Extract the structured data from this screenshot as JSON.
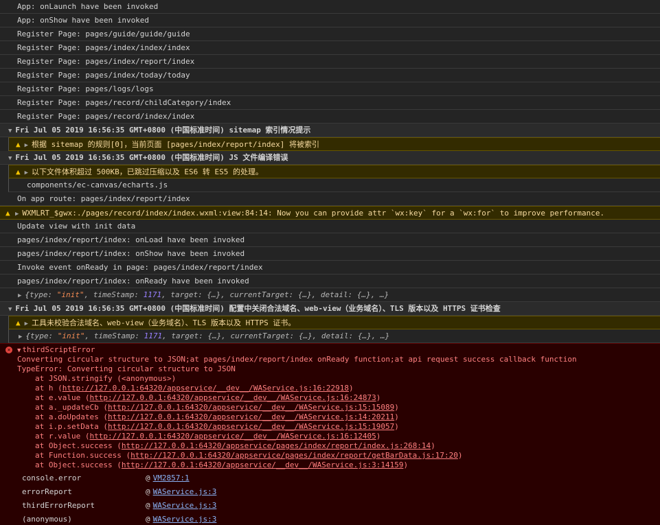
{
  "logs": [
    "App: onLaunch have been invoked",
    "App: onShow have been invoked",
    "Register Page: pages/guide/guide/guide",
    "Register Page: pages/index/index/index",
    "Register Page: pages/index/report/index",
    "Register Page: pages/index/today/today",
    "Register Page: pages/logs/logs",
    "Register Page: pages/record/childCategory/index",
    "Register Page: pages/record/index/index"
  ],
  "group1": {
    "header": "Fri Jul 05 2019 16:56:35 GMT+0800 (中国标准时间) sitemap 索引情况提示",
    "warning": "根据 sitemap 的规则[0]，当前页面 [pages/index/report/index] 将被索引"
  },
  "group2": {
    "header": "Fri Jul 05 2019 16:56:35 GMT+0800 (中国标准时间) JS 文件编译错误",
    "warning": "以下文件体积超过 500KB，已跳过压缩以及 ES6 转 ES5 的处理。",
    "file": "components/ec-canvas/echarts.js"
  },
  "route": "On app route: pages/index/report/index",
  "wxml_warning": "WXMLRT_$gwx:./pages/record/index/index.wxml:view:84:14: Now you can provide attr `wx:key` for a `wx:for` to improve performance.",
  "logs2": [
    "Update view with init data",
    "pages/index/report/index: onLoad have been invoked",
    "pages/index/report/index: onShow have been invoked",
    "Invoke event onReady in page: pages/index/report/index",
    "pages/index/report/index: onReady have been invoked"
  ],
  "obj": {
    "brace_open": "{",
    "type_key": "type: ",
    "type_val": "\"init\"",
    "ts_key": ", timeStamp: ",
    "ts_val": "1171",
    "rest": ", target: {…}, currentTarget: {…}, detail: {…}, …}"
  },
  "group3": {
    "header": "Fri Jul 05 2019 16:56:35 GMT+0800 (中国标准时间) 配置中关闭合法域名、web-view（业务域名）、TLS 版本以及 HTTPS 证书检查",
    "warning": "工具未校验合法域名、web-view（业务域名）、TLS 版本以及 HTTPS 证书。"
  },
  "error": {
    "title": "thirdScriptError",
    "message": "Converting circular structure to JSON;at pages/index/report/index onReady function;at api request success callback function",
    "type_error": "TypeError: Converting circular structure to JSON",
    "stack": [
      {
        "prefix": "at JSON.stringify (<anonymous>)",
        "link": "",
        "suffix": ""
      },
      {
        "prefix": "at h (",
        "link": "http://127.0.0.1:64320/appservice/__dev__/WAService.js:16:22918",
        "suffix": ")"
      },
      {
        "prefix": "at e.value (",
        "link": "http://127.0.0.1:64320/appservice/__dev__/WAService.js:16:24873",
        "suffix": ")"
      },
      {
        "prefix": "at a._updateCb (",
        "link": "http://127.0.0.1:64320/appservice/__dev__/WAService.js:15:15089",
        "suffix": ")"
      },
      {
        "prefix": "at a.doUpdates (",
        "link": "http://127.0.0.1:64320/appservice/__dev__/WAService.js:14:20211",
        "suffix": ")"
      },
      {
        "prefix": "at i.p.setData (",
        "link": "http://127.0.0.1:64320/appservice/__dev__/WAService.js:15:19057",
        "suffix": ")"
      },
      {
        "prefix": "at r.value (",
        "link": "http://127.0.0.1:64320/appservice/__dev__/WAService.js:16:12405",
        "suffix": ")"
      },
      {
        "prefix": "at Object.success (",
        "link": "http://127.0.0.1:64320/appservice/pages/index/report/index.js:268:14",
        "suffix": ")"
      },
      {
        "prefix": "at Function.success (",
        "link": "http://127.0.0.1:64320/appservice/pages/index/report/getBarData.js:17:20",
        "suffix": ")"
      },
      {
        "prefix": "at Object.success (",
        "link": "http://127.0.0.1:64320/appservice/__dev__/WAService.js:3:14159",
        "suffix": ")"
      }
    ],
    "trace": [
      {
        "fn": "console.error",
        "at": "@",
        "src": "VM2857:1"
      },
      {
        "fn": "errorReport",
        "at": "@",
        "src": "WAService.js:3"
      },
      {
        "fn": "thirdErrorReport",
        "at": "@",
        "src": "WAService.js:3"
      },
      {
        "fn": "(anonymous)",
        "at": "@",
        "src": "WAService.js:3"
      }
    ]
  },
  "icons": {
    "triangle_down": "▼",
    "triangle_right": "▶",
    "warning": "▲",
    "error": "✕"
  },
  "colors": {
    "background": "#242424",
    "warning_bg": "#332b00",
    "error_bg": "#290000",
    "error_text": "#ff8080",
    "link": "#8ab4f8"
  }
}
